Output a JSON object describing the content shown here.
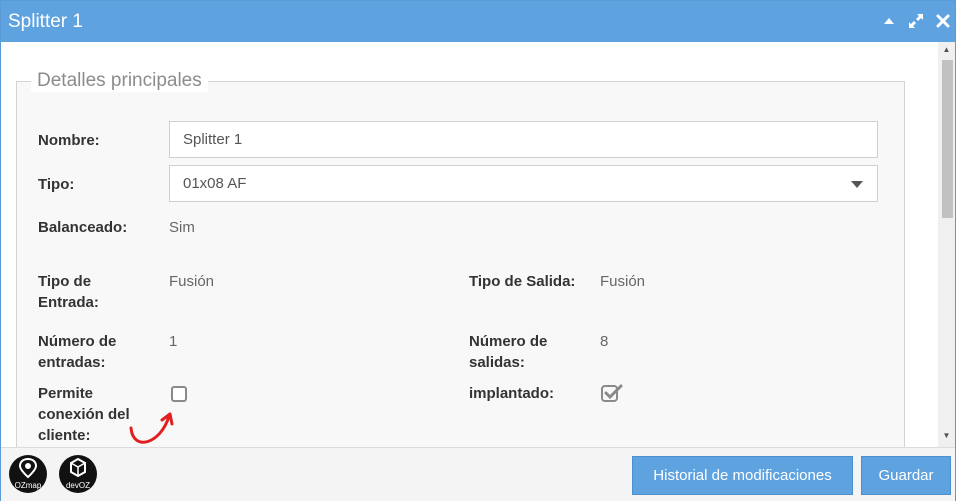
{
  "window": {
    "title": "Splitter 1"
  },
  "titlebar_icons": {
    "collapse": "chevron-up-icon",
    "maximize": "expand-icon",
    "close": "close-icon"
  },
  "section": {
    "legend": "Detalles principales"
  },
  "form": {
    "nombre_label": "Nombre:",
    "nombre_value": "Splitter 1",
    "tipo_label": "Tipo:",
    "tipo_value": "01x08 AF",
    "balanceado_label": "Balanceado:",
    "balanceado_value": "Sim",
    "tipo_entrada_label_1": "Tipo de",
    "tipo_entrada_label_2": "Entrada:",
    "tipo_entrada_value": "Fusión",
    "tipo_salida_label": "Tipo de Salida:",
    "tipo_salida_value": "Fusión",
    "num_entradas_label_1": "Número de",
    "num_entradas_label_2": "entradas:",
    "num_entradas_value": "1",
    "num_salidas_label_1": "Número de",
    "num_salidas_label_2": "salidas:",
    "num_salidas_value": "8",
    "permite_label_1": "Permite",
    "permite_label_2": "conexión del",
    "permite_label_3": "cliente:",
    "permite_checked": false,
    "implantado_label": "implantado:",
    "implantado_checked": true
  },
  "footer": {
    "logo1_text": "OZmap",
    "logo2_text": "devOZ",
    "history_button": "Historial de modificaciones",
    "save_button": "Guardar"
  },
  "colors": {
    "accent": "#5ea2df",
    "annotation": "#e02020"
  }
}
